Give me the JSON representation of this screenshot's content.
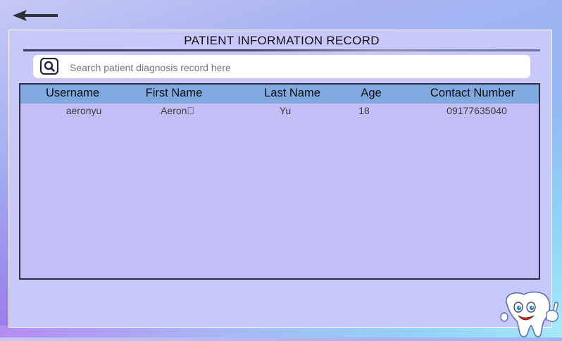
{
  "back": {
    "icon": "arrow-left-icon"
  },
  "panel": {
    "title": "PATIENT INFORMATION RECORD"
  },
  "search": {
    "icon": "search-icon",
    "placeholder": "Search patient diagnosis record here",
    "value": ""
  },
  "table": {
    "columns": [
      "Username",
      "First Name",
      "Last Name",
      "Age",
      "Contact Number"
    ],
    "rows": [
      [
        "aeronyu",
        "Aeron\u0000",
        "Yu",
        "18",
        "09177635040"
      ]
    ]
  },
  "mascot": {
    "icon": "tooth-mascot-thumbs-up-icon"
  }
}
